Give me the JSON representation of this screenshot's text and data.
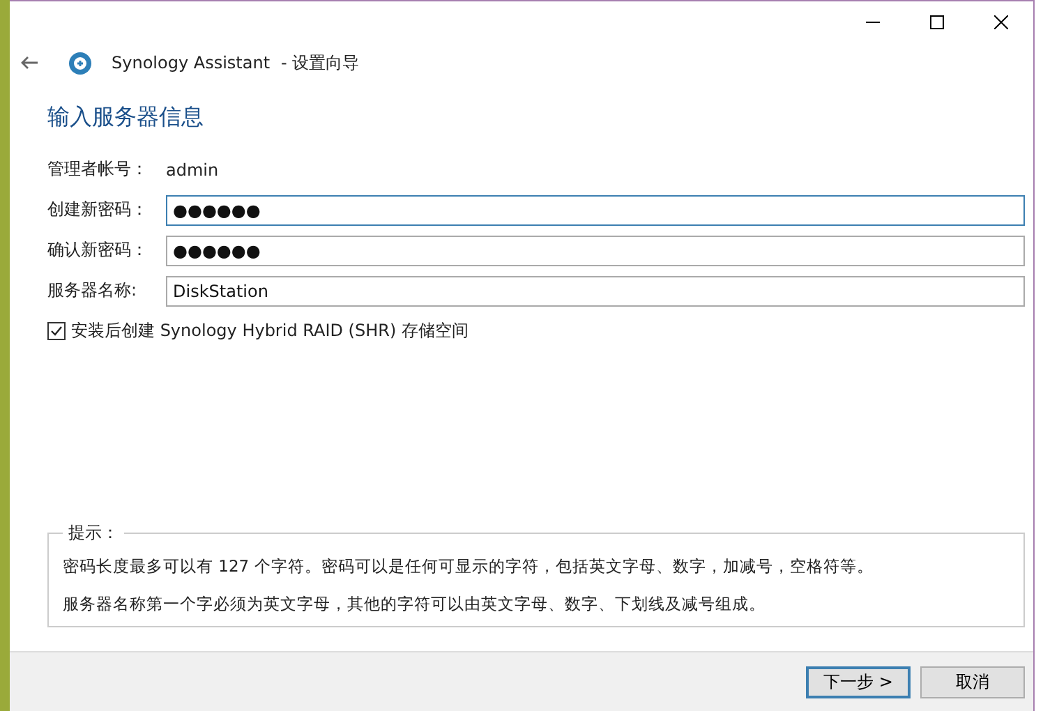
{
  "window": {
    "title": "Synology Assistant",
    "subtitle": "- 设置向导"
  },
  "heading": "输入服务器信息",
  "fields": [
    {
      "kind": "text",
      "label": "管理者帐号：",
      "value": "admin"
    },
    {
      "kind": "password",
      "label": "创建新密码：",
      "value": "●●●●●●",
      "focused": true
    },
    {
      "kind": "password",
      "label": "确认新密码：",
      "value": "●●●●●●",
      "focused": false
    },
    {
      "kind": "input",
      "label": "服务器名称:",
      "value": "DiskStation",
      "focused": false
    }
  ],
  "option": {
    "label": "安装后创建 Synology Hybrid RAID (SHR) 存储空间",
    "checked": true
  },
  "hint": {
    "title": "提示：",
    "lines": [
      "密码长度最多可以有 127 个字符。密码可以是任何可显示的字符，包括英文字母、数字，加减号，空格符等。",
      "服务器名称第一个字必须为英文字母，其他的字符可以由英文字母、数字、下划线及减号组成。"
    ]
  },
  "buttons": [
    {
      "label": "下一步 >",
      "default": true
    },
    {
      "label": "取消",
      "default": false
    }
  ]
}
